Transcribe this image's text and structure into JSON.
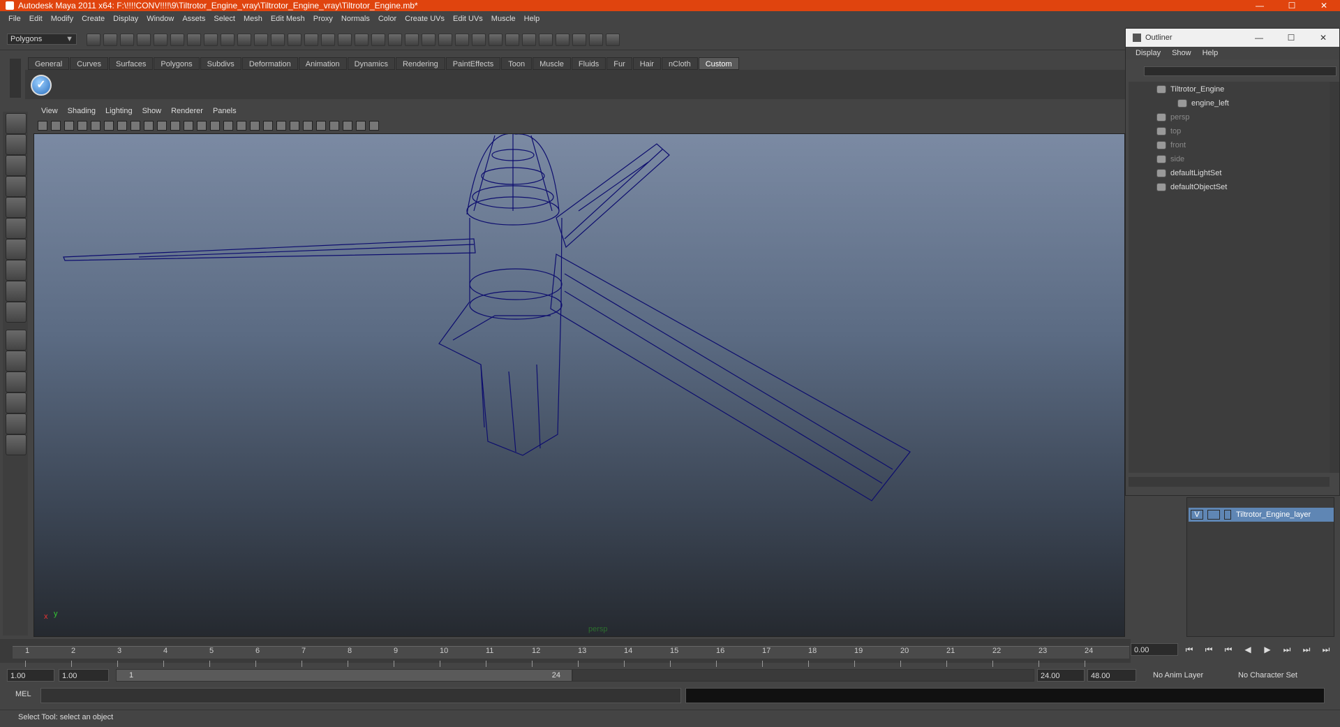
{
  "window": {
    "title": "Autodesk Maya 2011 x64: F:\\!!!!CONV!!!!\\9\\Tiltrotor_Engine_vray\\Tiltrotor_Engine_vray\\Tiltrotor_Engine.mb*",
    "minimize": "—",
    "maximize": "☐",
    "close": "✕"
  },
  "menubar": [
    "File",
    "Edit",
    "Modify",
    "Create",
    "Display",
    "Window",
    "Assets",
    "Select",
    "Mesh",
    "Edit Mesh",
    "Proxy",
    "Normals",
    "Color",
    "Create UVs",
    "Edit UVs",
    "Muscle",
    "Help"
  ],
  "statusline": {
    "mode": "Polygons",
    "mode_arrow": "▼"
  },
  "shelf": {
    "tabs": [
      "General",
      "Curves",
      "Surfaces",
      "Polygons",
      "Subdivs",
      "Deformation",
      "Animation",
      "Dynamics",
      "Rendering",
      "PaintEffects",
      "Toon",
      "Muscle",
      "Fluids",
      "Fur",
      "Hair",
      "nCloth",
      "Custom"
    ],
    "active_tab": "Custom",
    "button_icon": "✓"
  },
  "toolbox": {
    "tools": [
      "select-tool",
      "lasso-tool",
      "paint-select-tool",
      "move-tool",
      "rotate-tool",
      "scale-tool",
      "universal-manipulator",
      "soft-mod-tool",
      "show-manipulator",
      "last-tool",
      "layout-single",
      "layout-four",
      "layout-outliner",
      "layout-graph",
      "layout-hypershade",
      "layout-custom"
    ]
  },
  "panel": {
    "menus": [
      "View",
      "Shading",
      "Lighting",
      "Show",
      "Renderer",
      "Panels"
    ],
    "camera_label": "persp",
    "axis_x": "x",
    "axis_y": "y"
  },
  "outliner": {
    "title": "Outliner",
    "minimize": "—",
    "maximize": "☐",
    "close": "✕",
    "menus": [
      "Display",
      "Show",
      "Help"
    ],
    "items": [
      {
        "label": "Tiltrotor_Engine",
        "dim": false
      },
      {
        "label": "engine_left",
        "dim": false
      },
      {
        "label": "persp",
        "dim": true
      },
      {
        "label": "top",
        "dim": true
      },
      {
        "label": "front",
        "dim": true
      },
      {
        "label": "side",
        "dim": true
      },
      {
        "label": "defaultLightSet",
        "dim": false
      },
      {
        "label": "defaultObjectSet",
        "dim": false
      }
    ]
  },
  "layers": {
    "layer_name": "Tiltrotor_Engine_layer",
    "visible": "V"
  },
  "timeline": {
    "ticks": [
      "1",
      "2",
      "3",
      "4",
      "5",
      "6",
      "7",
      "8",
      "9",
      "10",
      "11",
      "12",
      "13",
      "14",
      "15",
      "16",
      "17",
      "18",
      "19",
      "20",
      "21",
      "22",
      "23",
      "24"
    ],
    "current_frame": "0.00",
    "playback": [
      "⏮",
      "⏮",
      "⏮",
      "◀",
      "▶",
      "⏭",
      "⏭",
      "⏭"
    ]
  },
  "range": {
    "start": "1.00",
    "playback_start": "1.00",
    "slider_low": "1",
    "slider_high": "24",
    "playback_end": "24.00",
    "end": "48.00",
    "anim_layer": "No Anim Layer",
    "character_set": "No Character Set"
  },
  "cmdline": {
    "label": "MEL"
  },
  "helpline": {
    "text": "Select Tool: select an object"
  },
  "colors": {
    "titlebar": "#e0440e",
    "wireframe": "#0d0d6e",
    "layer_highlight": "#5f86b4"
  }
}
